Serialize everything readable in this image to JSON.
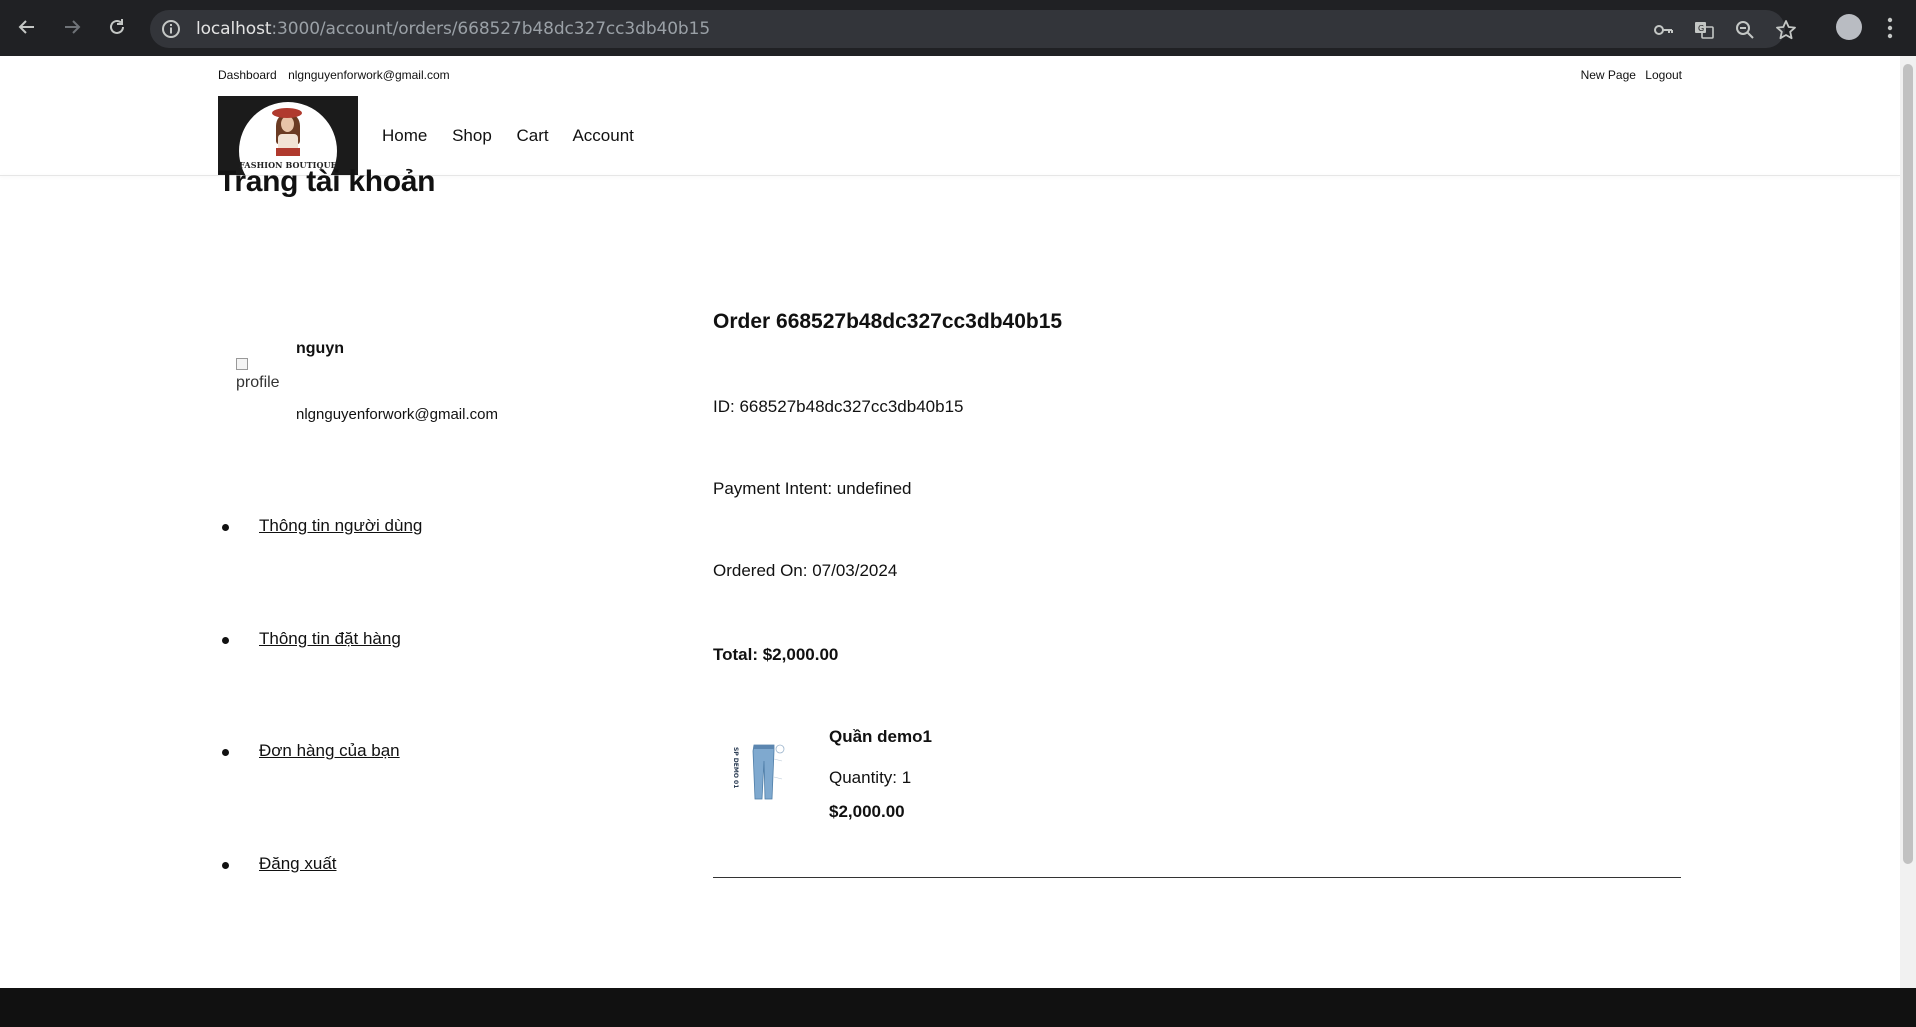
{
  "browser": {
    "url_host": "localhost",
    "url_path": ":3000/account/orders/668527b48dc327cc3db40b15",
    "icons": [
      "back-icon",
      "forward-icon",
      "reload-icon",
      "info-icon",
      "password-key-icon",
      "translate-icon",
      "zoom-icon",
      "star-icon",
      "profile-avatar-icon",
      "kebab-menu-icon"
    ]
  },
  "topbar": {
    "dashboard": "Dashboard",
    "user_email": "nlgnguyenforwork@gmail.com",
    "new_page": "New Page",
    "logout": "Logout"
  },
  "logo": {
    "brand": "FASHION BOUTIQUE"
  },
  "nav": {
    "home": "Home",
    "shop": "Shop",
    "cart": "Cart",
    "account": "Account"
  },
  "page": {
    "title": "Trang tài khoản"
  },
  "profile": {
    "avatar_alt": "profile",
    "name": "nguyn",
    "email": "nlgnguyenforwork@gmail.com"
  },
  "side_menu": [
    {
      "label": "Thông tin người dùng"
    },
    {
      "label": "Thông tin đặt hàng"
    },
    {
      "label": "Đơn hàng của bạn"
    },
    {
      "label": "Đăng xuất"
    }
  ],
  "order": {
    "title": "Order 668527b48dc327cc3db40b15",
    "id_line": "ID: 668527b48dc327cc3db40b15",
    "payment_line": "Payment Intent: undefined",
    "ordered_line": "Ordered On: 07/03/2024",
    "total_line": "Total: $2,000.00",
    "items": [
      {
        "name": "Quần demo1",
        "quantity_line": "Quantity: 1",
        "price": "$2,000.00",
        "thumb_text": "SP DEMO 01"
      }
    ]
  },
  "colors": {
    "chrome_bg": "#202124",
    "omnibox_bg": "#33353a",
    "text": "#111111",
    "jeans_blue": "#7fa9cf"
  }
}
